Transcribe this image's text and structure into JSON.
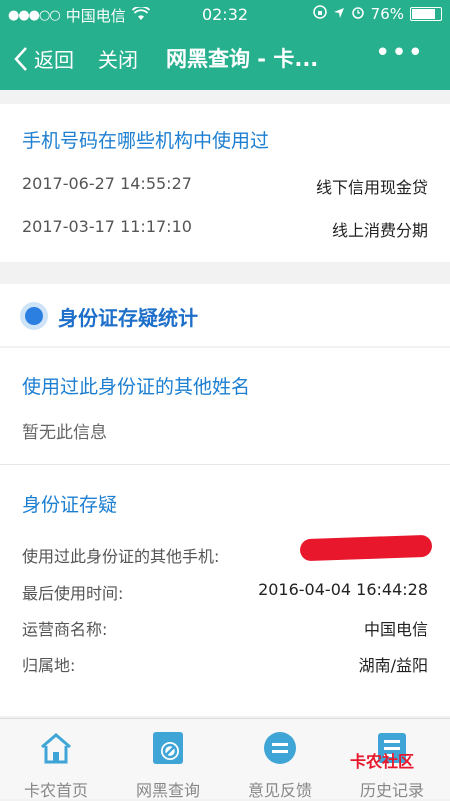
{
  "status_bar": {
    "carrier": "中国电信",
    "time": "02:32",
    "battery": "76%"
  },
  "nav": {
    "back_label": "返回",
    "close_label": "关闭",
    "title": "网黑查询 - 卡...",
    "more_label": "•••"
  },
  "phone_usage": {
    "heading": "手机号码在哪些机构中使用过",
    "records": [
      {
        "time": "2017-06-27 14:55:27",
        "type": "线下信用现金贷"
      },
      {
        "time": "2017-03-17 11:17:10",
        "type": "线上消费分期"
      }
    ]
  },
  "id_stats": {
    "heading": "身份证存疑统计"
  },
  "other_names": {
    "heading": "使用过此身份证的其他姓名",
    "empty_text": "暂无此信息"
  },
  "id_suspect": {
    "heading": "身份证存疑",
    "rows": [
      {
        "label": "使用过此身份证的其他手机:",
        "value": ""
      },
      {
        "label": "最后使用时间:",
        "value": "2016-04-04 16:44:28"
      },
      {
        "label": "运营商名称:",
        "value": "中国电信"
      },
      {
        "label": "归属地:",
        "value": "湖南/益阳"
      }
    ]
  },
  "tabs": [
    {
      "label": "卡农首页",
      "icon": "home-icon"
    },
    {
      "label": "网黑查询",
      "icon": "search-block-icon"
    },
    {
      "label": "意见反馈",
      "icon": "feedback-icon"
    },
    {
      "label": "历史记录",
      "icon": "history-icon"
    }
  ],
  "watermark": "卡农社区",
  "colors": {
    "brand": "#27b08d",
    "heading": "#1d7fd1",
    "redaction": "#e8172c"
  }
}
